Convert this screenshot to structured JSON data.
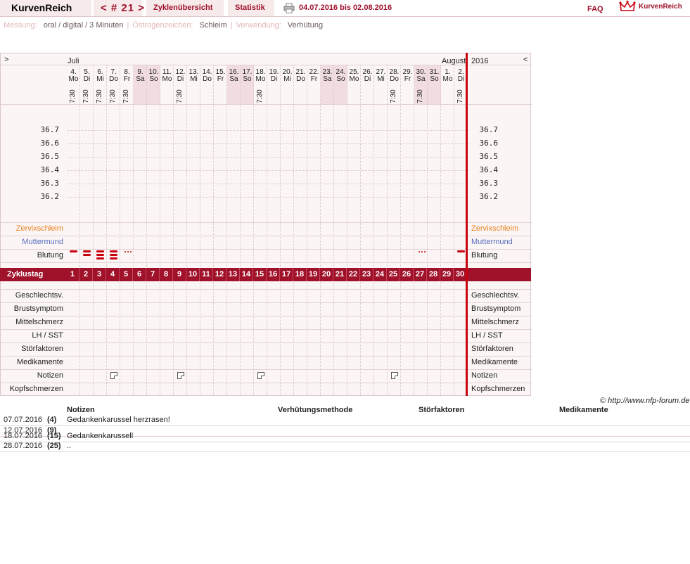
{
  "header": {
    "brand": "KurvenReich",
    "cycle_nav": "< # 21 >",
    "tab_cycle_overview": "Zyklenübersicht",
    "tab_statistics": "Statistik",
    "date_range": "04.07.2016 bis 02.08.2016",
    "faq": "FAQ",
    "logo_text": "KurvenReich"
  },
  "subheader": {
    "measure_label": "Messung:",
    "measure_value": "oral / digital / 3 Minuten",
    "estrogen_label": "Östrogenzeichen:",
    "estrogen_value": "Schleim",
    "use_label": "Verwendung:",
    "use_value": "Verhütung"
  },
  "chart": {
    "nav_left": ">",
    "nav_right": "<",
    "month_left": "Juli",
    "month_right": "August",
    "year": "2016",
    "days": [
      {
        "d": "4.",
        "w": "Mo",
        "t": "7:30",
        "we": false
      },
      {
        "d": "5.",
        "w": "Di",
        "t": "7:30",
        "we": false
      },
      {
        "d": "6.",
        "w": "Mi",
        "t": "7:30",
        "we": false
      },
      {
        "d": "7.",
        "w": "Do",
        "t": "7:30",
        "we": false
      },
      {
        "d": "8.",
        "w": "Fr",
        "t": "7:30",
        "we": false
      },
      {
        "d": "9.",
        "w": "Sa",
        "t": "",
        "we": true
      },
      {
        "d": "10.",
        "w": "So",
        "t": "",
        "we": true
      },
      {
        "d": "11.",
        "w": "Mo",
        "t": "",
        "we": false
      },
      {
        "d": "12.",
        "w": "Di",
        "t": "7:30",
        "we": false
      },
      {
        "d": "13.",
        "w": "Mi",
        "t": "",
        "we": false
      },
      {
        "d": "14.",
        "w": "Do",
        "t": "",
        "we": false
      },
      {
        "d": "15.",
        "w": "Fr",
        "t": "",
        "we": false
      },
      {
        "d": "16.",
        "w": "Sa",
        "t": "",
        "we": true
      },
      {
        "d": "17.",
        "w": "So",
        "t": "",
        "we": true
      },
      {
        "d": "18.",
        "w": "Mo",
        "t": "7:30",
        "we": false
      },
      {
        "d": "19.",
        "w": "Di",
        "t": "",
        "we": false
      },
      {
        "d": "20.",
        "w": "Mi",
        "t": "",
        "we": false
      },
      {
        "d": "21.",
        "w": "Do",
        "t": "",
        "we": false
      },
      {
        "d": "22.",
        "w": "Fr",
        "t": "",
        "we": false
      },
      {
        "d": "23.",
        "w": "Sa",
        "t": "",
        "we": true
      },
      {
        "d": "24.",
        "w": "So",
        "t": "",
        "we": true
      },
      {
        "d": "25.",
        "w": "Mo",
        "t": "",
        "we": false
      },
      {
        "d": "26.",
        "w": "Di",
        "t": "",
        "we": false
      },
      {
        "d": "27.",
        "w": "Mi",
        "t": "",
        "we": false
      },
      {
        "d": "28.",
        "w": "Do",
        "t": "7:30",
        "we": false
      },
      {
        "d": "29.",
        "w": "Fr",
        "t": "",
        "we": false
      },
      {
        "d": "30.",
        "w": "Sa",
        "t": "7:30",
        "we": true
      },
      {
        "d": "31.",
        "w": "So",
        "t": "",
        "we": true
      },
      {
        "d": "1.",
        "w": "Mo",
        "t": "",
        "we": false
      },
      {
        "d": "2.",
        "w": "Di",
        "t": "7:30",
        "we": false
      }
    ],
    "y_ticks": [
      "36.7",
      "36.6",
      "36.5",
      "36.4",
      "36.3",
      "36.2"
    ],
    "rows_top": [
      "Zervixschleim",
      "Muttermund",
      "Blutung"
    ],
    "cycle_label": "Zyklustag",
    "rows_bottom": [
      "Geschlechtsv.",
      "Brustsymptom",
      "Mittelschmerz",
      "LH / SST",
      "Störfaktoren",
      "Medikamente",
      "Notizen",
      "Kopfschmerzen"
    ],
    "colors": {
      "zervix": "#e8801a",
      "muttermund": "#5a6fbf",
      "accent": "#a0112a",
      "bleed": "#c8000e"
    },
    "bleeding": [
      2,
      3,
      4,
      4,
      1,
      0,
      0,
      0,
      0,
      0,
      0,
      0,
      0,
      0,
      0,
      0,
      0,
      0,
      0,
      0,
      0,
      0,
      0,
      0,
      0,
      0,
      1,
      0,
      0,
      2
    ],
    "notes_days": [
      4,
      9,
      15,
      25
    ]
  },
  "copyright": "© http://www.nfp-forum.de",
  "notes_table": {
    "headers": [
      "Notizen",
      "Verhütungsmethode",
      "Störfaktoren",
      "Medikamente"
    ],
    "rows": [
      {
        "date": "07.07.2016",
        "cd": "(4)",
        "note": "Gedankenkarussel herzrasen!"
      },
      {
        "date": "12.07.2016",
        "cd": "(9)",
        "note": ""
      },
      {
        "date": "18.07.2016",
        "cd": "(15)",
        "note": "Gedankenkarussell"
      },
      {
        "date": "28.07.2016",
        "cd": "(25)",
        "note": ".."
      }
    ]
  }
}
